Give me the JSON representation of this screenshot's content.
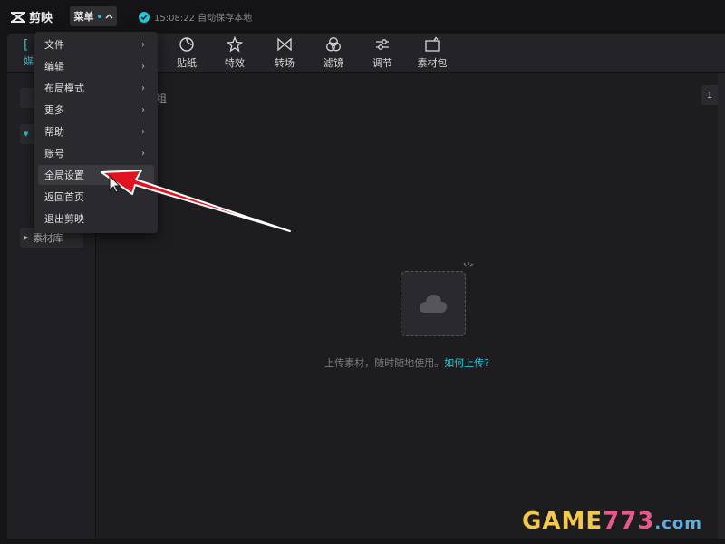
{
  "app": {
    "title": "剪映"
  },
  "topbar": {
    "menu_label": "菜单",
    "save_status": "15:08:22 自动保存本地"
  },
  "toolbar": {
    "media_label": "媒",
    "tools": [
      {
        "label": "贴纸",
        "icon": "sticker-icon"
      },
      {
        "label": "特效",
        "icon": "effects-star-icon"
      },
      {
        "label": "转场",
        "icon": "transition-icon"
      },
      {
        "label": "滤镜",
        "icon": "filter-icon"
      },
      {
        "label": "调节",
        "icon": "adjust-sliders-icon"
      },
      {
        "label": "素材包",
        "icon": "material-pack-icon"
      }
    ]
  },
  "sidebar": {
    "library_label": "素材库"
  },
  "content": {
    "group_label": "组",
    "sort_label": "1",
    "upload_hint": "上传素材，随时随地使用。",
    "upload_link": "如何上传?"
  },
  "dropdown": {
    "items": [
      {
        "label": "文件",
        "submenu": true
      },
      {
        "label": "编辑",
        "submenu": true
      },
      {
        "label": "布局模式",
        "submenu": true
      },
      {
        "label": "更多",
        "submenu": true
      },
      {
        "label": "帮助",
        "submenu": true
      },
      {
        "label": "账号",
        "submenu": true
      },
      {
        "label": "全局设置",
        "submenu": false
      },
      {
        "label": "返回首页",
        "submenu": false
      },
      {
        "label": "退出剪映",
        "submenu": false
      }
    ],
    "highlighted": "全局设置"
  },
  "colors": {
    "accent": "#21c6d6",
    "annotation_arrow": "#e0141e",
    "background": "#141416"
  },
  "watermark": {
    "part1": "GAME",
    "part2": "773",
    "part3": ".com"
  }
}
